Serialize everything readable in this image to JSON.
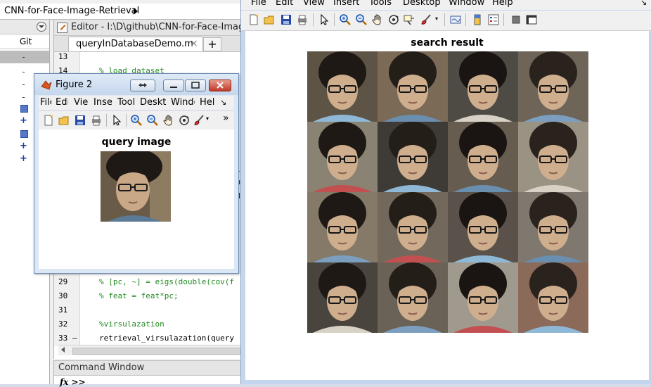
{
  "desktop": {
    "breadcrumb": "CNN-for-Face-Image-Retrieval",
    "file_browser": {
      "column_header": "Git"
    },
    "editor": {
      "title": "Editor - I:\\D\\github\\CNN-for-Face-Image",
      "tab_label": "queryInDatabaseDemo.m",
      "lines": [
        {
          "num": "13",
          "text": ""
        },
        {
          "num": "14",
          "text": "% load dataset"
        },
        {
          "num": "29",
          "text": "% [pc, ~] = eigs(double(cov(f"
        },
        {
          "num": "30",
          "text": "% feat = feat*pc;"
        },
        {
          "num": "31",
          "text": ""
        },
        {
          "num": "32",
          "text": "%virsulazation"
        },
        {
          "num": "33",
          "text": "retrieval_virsulazation(query",
          "marker": "–"
        }
      ]
    },
    "command_window": {
      "title": "Command Window",
      "prompt": "fx >>"
    }
  },
  "figure2": {
    "title": "Figure 2",
    "menu": [
      "File",
      "Edit",
      "View",
      "Insert",
      "Tools",
      "Desktop",
      "Window",
      "Help"
    ],
    "canvas_title": "query image"
  },
  "figure1": {
    "menu": [
      "File",
      "Edit",
      "View",
      "Insert",
      "Tools",
      "Desktop",
      "Window",
      "Help"
    ],
    "canvas_title": "search result"
  }
}
